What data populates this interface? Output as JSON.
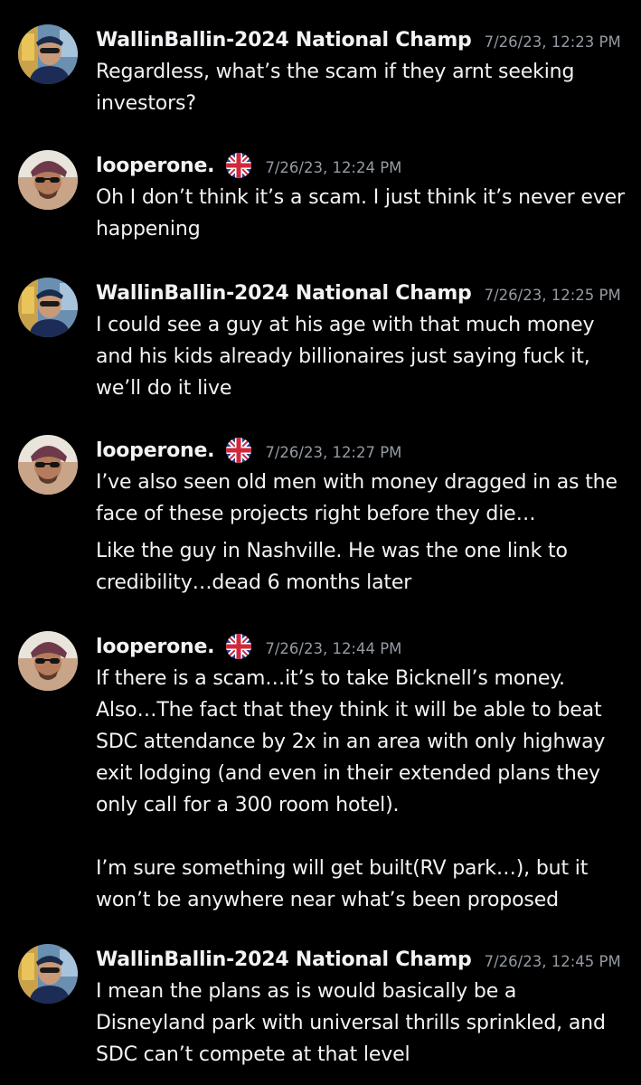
{
  "colors": {
    "background": "#000000",
    "text": "#f2f3f5",
    "timestamp": "#949ba4"
  },
  "messages": [
    {
      "author": "WallinBallin-2024 National Champ",
      "timestamp": "7/26/23, 12:23 PM",
      "flag": "",
      "lines": [
        "Regardless, what’s the scam if they arnt seeking",
        "investors?"
      ]
    },
    {
      "author": "looperone.",
      "timestamp": "7/26/23, 12:24 PM",
      "flag": "uk-flag-icon",
      "lines": [
        "Oh I don’t think it’s a scam. I just think it’s never ever",
        "happening"
      ]
    },
    {
      "author": "WallinBallin-2024 National Champ",
      "timestamp": "7/26/23, 12:25 PM",
      "flag": "",
      "lines": [
        "I could see a guy at his age with that much money",
        "and his kids already billionaires just saying fuck it,",
        "we’ll do it live"
      ]
    },
    {
      "author": "looperone.",
      "timestamp": "7/26/23, 12:27 PM",
      "flag": "uk-flag-icon",
      "lines": [
        "I’ve also seen old men with money dragged in as the",
        "face of these projects right before they die…"
      ],
      "followup_lines": [
        "Like the guy in Nashville. He was the one link to",
        "credibility…dead 6 months later"
      ]
    },
    {
      "author": "looperone.",
      "timestamp": "7/26/23, 12:44 PM",
      "flag": "uk-flag-icon",
      "lines": [
        "If there is a scam…it’s to take Bicknell’s money.",
        "Also…The fact that they think it will be able to beat",
        "SDC attendance by 2x in an area with only highway",
        "exit lodging (and even in their extended plans they",
        "only call for a 300 room hotel).",
        "",
        "I’m sure something will get built(RV park…), but it",
        "won’t be anywhere near what’s been proposed"
      ]
    },
    {
      "author": "WallinBallin-2024 National Champ",
      "timestamp": "7/26/23, 12:45 PM",
      "flag": "",
      "lines": [
        "I mean the plans as is would basically be a",
        "Disneyland park with universal thrills sprinkled, and",
        "SDC can’t compete at that level"
      ]
    }
  ]
}
